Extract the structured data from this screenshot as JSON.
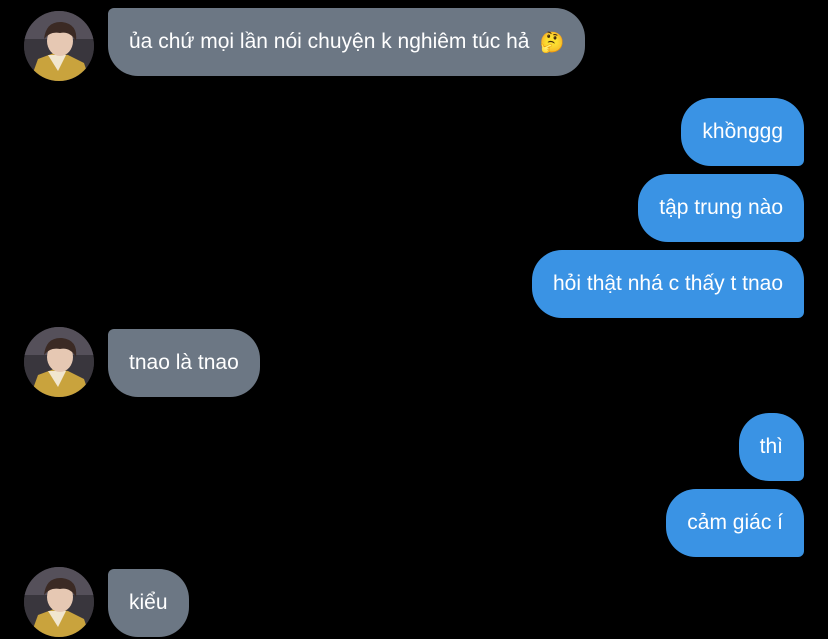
{
  "messages": [
    {
      "side": "in",
      "text": "ủa chứ mọi lần nói chuyện k nghiêm túc hả",
      "emoji": "🤔"
    },
    {
      "side": "out",
      "text": "khồnggg"
    },
    {
      "side": "out",
      "text": "tập trung nào"
    },
    {
      "side": "out",
      "text": "hỏi thật nhá c thấy t tnao"
    },
    {
      "side": "in",
      "text": "tnao là tnao"
    },
    {
      "side": "out",
      "text": "thì"
    },
    {
      "side": "out",
      "text": "cảm giác í"
    },
    {
      "side": "in",
      "text": "kiểu"
    }
  ],
  "colors": {
    "background": "#000000",
    "incoming_bubble": "#6c7784",
    "outgoing_bubble": "#3a93e4",
    "text": "#ffffff"
  },
  "icons": {
    "avatar": "contact-avatar-photo",
    "thinking": "thinking-face-emoji"
  }
}
